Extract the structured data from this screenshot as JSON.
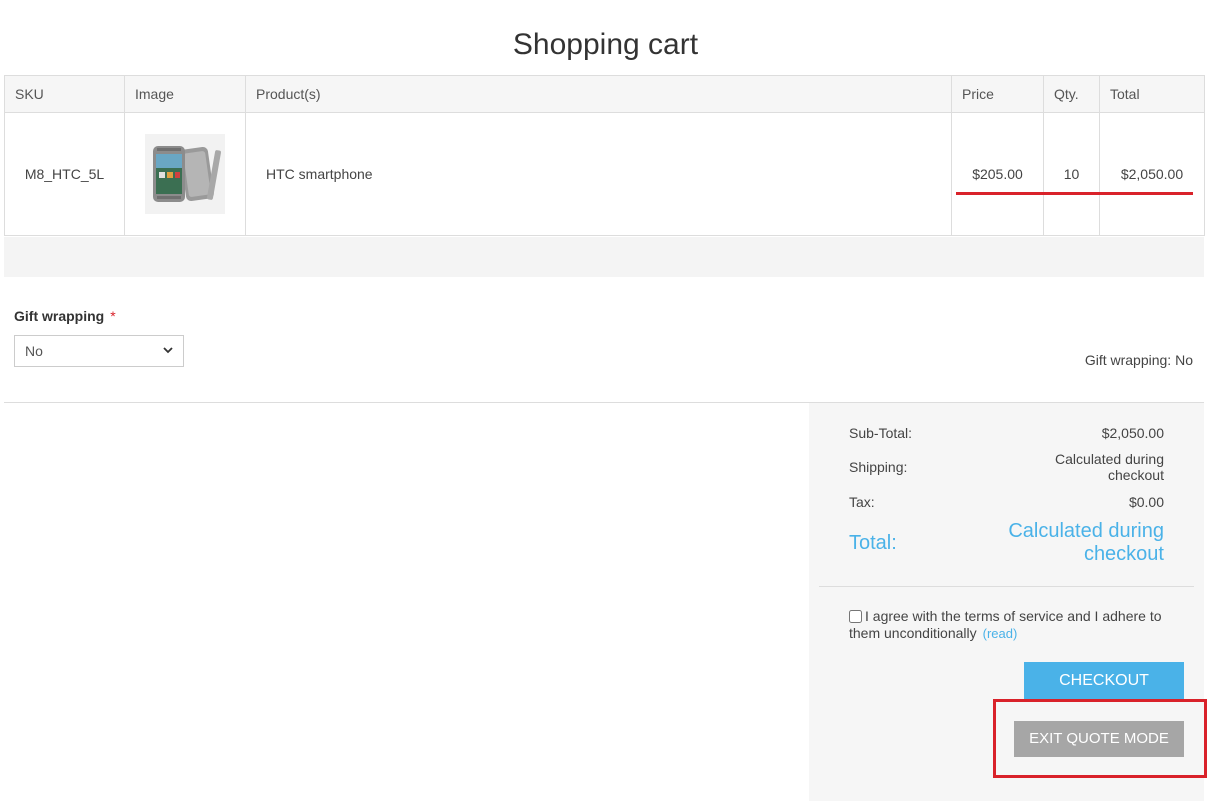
{
  "page": {
    "title": "Shopping cart"
  },
  "cart": {
    "headers": {
      "sku": "SKU",
      "image": "Image",
      "products": "Product(s)",
      "price": "Price",
      "qty": "Qty.",
      "total": "Total"
    },
    "items": [
      {
        "sku": "M8_HTC_5L",
        "image_icon": "htc-smartphone-thumbnail",
        "name": "HTC smartphone",
        "price": "$205.00",
        "qty": "10",
        "total": "$2,050.00"
      }
    ]
  },
  "gift_wrapping": {
    "label": "Gift wrapping",
    "required_mark": "*",
    "selected": "No",
    "info": "Gift wrapping: No"
  },
  "totals": {
    "subtotal_label": "Sub-Total:",
    "subtotal_value": "$2,050.00",
    "shipping_label": "Shipping:",
    "shipping_value_line1": "Calculated during",
    "shipping_value_line2": "checkout",
    "tax_label": "Tax:",
    "tax_value": "$0.00",
    "total_label": "Total:",
    "total_value_line1": "Calculated during",
    "total_value_line2": "checkout"
  },
  "terms": {
    "text": "I agree with the terms of service and I adhere to them unconditionally",
    "read_link": "(read)"
  },
  "buttons": {
    "checkout": "CHECKOUT",
    "exit_quote": "EXIT QUOTE MODE"
  },
  "colors": {
    "accent": "#4ab2e8",
    "highlight": "#d9222a",
    "secondary_button": "#a6a6a6"
  }
}
